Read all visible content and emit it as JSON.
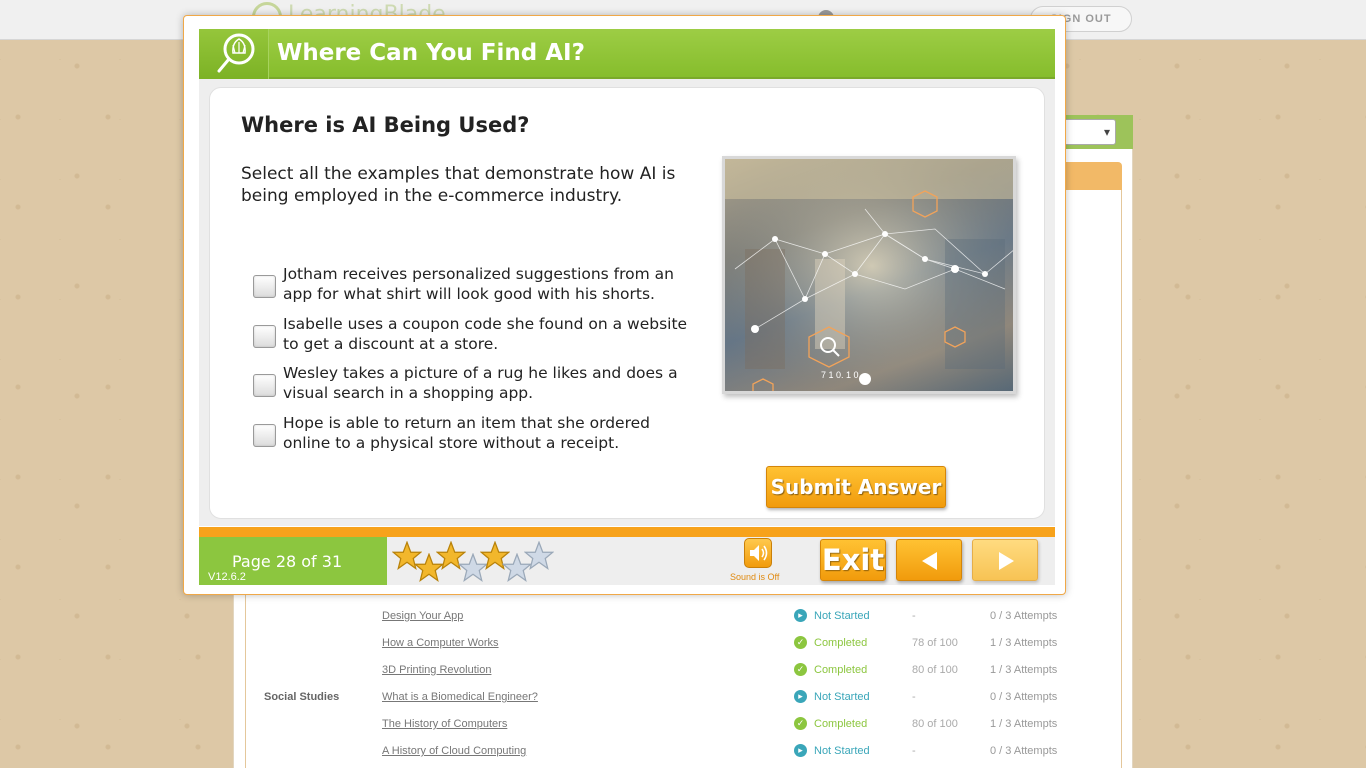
{
  "app": {
    "logo_text": "LearningBlade",
    "signout_label": "SIGN OUT"
  },
  "background_table": {
    "rows": [
      {
        "subject": "",
        "lesson": "Design Your App",
        "status": "Not Started",
        "score": "-",
        "attempts": "0 / 3 Attempts"
      },
      {
        "subject": "",
        "lesson": "How a Computer Works",
        "status": "Completed",
        "score": "78 of 100",
        "attempts": "1 / 3 Attempts"
      },
      {
        "subject": "",
        "lesson": "3D Printing Revolution",
        "status": "Completed",
        "score": "80 of 100",
        "attempts": "1 / 3 Attempts"
      },
      {
        "subject": "Social Studies",
        "lesson": "What is a Biomedical Engineer?",
        "status": "Not Started",
        "score": "-",
        "attempts": "0 / 3 Attempts"
      },
      {
        "subject": "",
        "lesson": "The History of Computers",
        "status": "Completed",
        "score": "80 of 100",
        "attempts": "1 / 3 Attempts"
      },
      {
        "subject": "",
        "lesson": "A History of Cloud Computing",
        "status": "Not Started",
        "score": "-",
        "attempts": "0 / 3 Attempts"
      }
    ]
  },
  "modal": {
    "header_title": "Where Can You Find AI?",
    "question_title": "Where is AI Being Used?",
    "instructions": "Select all the examples that demonstrate how AI is being employed in the e-commerce industry.",
    "options": [
      {
        "text": "Jotham receives personalized suggestions from an app for what shirt will look good with his shorts.",
        "checked": false
      },
      {
        "text": "Isabelle uses a coupon code she found on a website to get a discount at a store.",
        "checked": false
      },
      {
        "text": "Wesley takes a picture of a rug he likes and does a visual search in a shopping app.",
        "checked": false
      },
      {
        "text": "Hope is able to return an item that she ordered online to a physical store without a receipt.",
        "checked": false
      }
    ],
    "image_overlay_text": "7 1 0. 1 0",
    "submit_label": "Submit Answer",
    "footer": {
      "page_text": "Page 28 of 31",
      "version": "V12.6.2",
      "stars_filled": 4,
      "stars_total": 7,
      "sound_label": "Sound is Off",
      "exit_label": "Exit"
    }
  },
  "colors": {
    "header_green": "#8cc63f",
    "accent_orange": "#f7a21b",
    "status_not_started": "#3aa6b9",
    "status_completed": "#8cc63f"
  }
}
